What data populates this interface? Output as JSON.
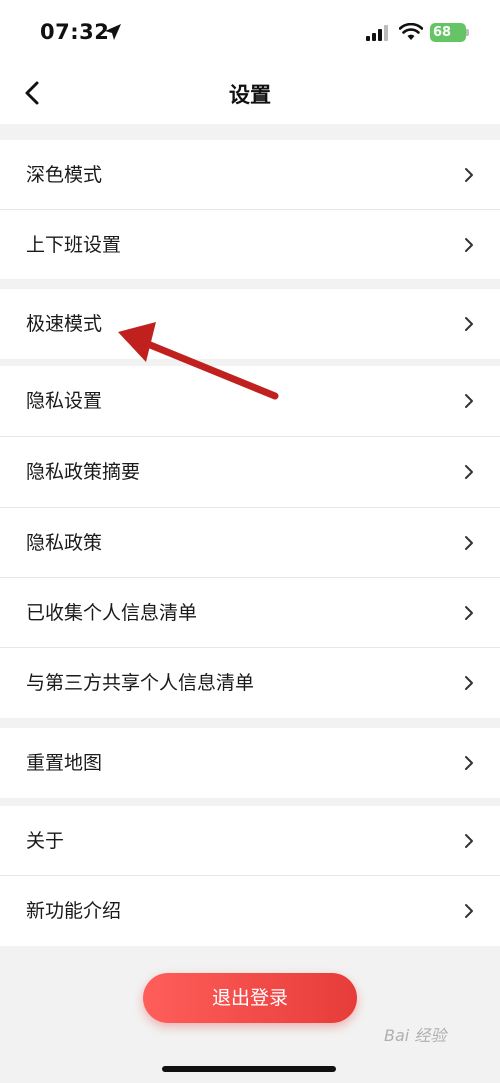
{
  "status_bar": {
    "time": "07:32",
    "battery": "68"
  },
  "nav": {
    "title": "设置"
  },
  "groups": [
    {
      "items": [
        {
          "label": "深色模式"
        },
        {
          "label": "上下班设置"
        }
      ]
    },
    {
      "items": [
        {
          "label": "极速模式"
        }
      ]
    },
    {
      "items": [
        {
          "label": "隐私设置"
        },
        {
          "label": "隐私政策摘要"
        },
        {
          "label": "隐私政策"
        },
        {
          "label": "已收集个人信息清单"
        },
        {
          "label": "与第三方共享个人信息清单"
        }
      ]
    },
    {
      "items": [
        {
          "label": "重置地图"
        }
      ]
    },
    {
      "items": [
        {
          "label": "关于"
        },
        {
          "label": "新功能介绍"
        }
      ]
    }
  ],
  "logout": {
    "label": "退出登录"
  },
  "watermark": "Bai 经验",
  "colors": {
    "accent": "#e63c3a",
    "battery": "#65c466",
    "annotation_arrow": "#c0211f"
  },
  "icons": [
    "location-arrow-icon",
    "signal-icon",
    "wifi-icon",
    "battery-icon",
    "back-chevron-icon",
    "chevron-right-icon"
  ]
}
